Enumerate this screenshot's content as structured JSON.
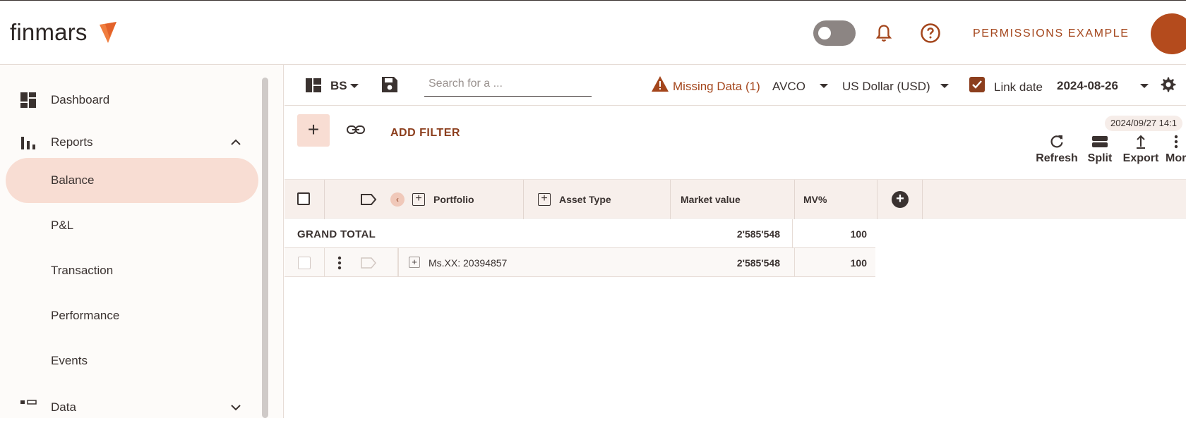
{
  "app": {
    "logo_text": "finmars",
    "user_label": "PERMISSIONS EXAMPLE"
  },
  "sidebar": {
    "items": [
      {
        "label": "Dashboard",
        "icon": "dashboard-icon"
      },
      {
        "label": "Reports",
        "icon": "bar-chart-icon",
        "expanded": true
      },
      {
        "label": "Balance",
        "active": true
      },
      {
        "label": "P&L"
      },
      {
        "label": "Transaction"
      },
      {
        "label": "Performance"
      },
      {
        "label": "Events"
      },
      {
        "label": "Data",
        "icon": "data-icon"
      }
    ]
  },
  "toolbar": {
    "layout_name": "BS",
    "search_placeholder": "Search for a ...",
    "missing_data": "Missing Data (1)",
    "cost_method": "AVCO",
    "currency": "US Dollar (USD)",
    "link_date_label": "Link date",
    "link_date_checked": true,
    "report_date": "2024-08-26"
  },
  "filterbar": {
    "add_filter_label": "ADD FILTER",
    "timestamp": "2024/09/27 14:1",
    "actions": [
      {
        "label": "Refresh",
        "icon": "refresh-icon"
      },
      {
        "label": "Split",
        "icon": "split-icon"
      },
      {
        "label": "Export",
        "icon": "export-icon"
      },
      {
        "label": "Mor",
        "icon": "more-vert-icon"
      }
    ]
  },
  "grid": {
    "columns": [
      "Portfolio",
      "Asset Type",
      "Market value",
      "MV%"
    ],
    "grand_total": {
      "label": "GRAND TOTAL",
      "market_value": "2'585'548",
      "mv_pct": "100"
    },
    "rows": [
      {
        "label": "Ms.XX: 20394857",
        "market_value": "2'585'548",
        "mv_pct": "100"
      }
    ]
  },
  "colors": {
    "accent": "#a4461c",
    "active_bg": "#f8ddd3",
    "header_bg": "#f7efeb"
  }
}
